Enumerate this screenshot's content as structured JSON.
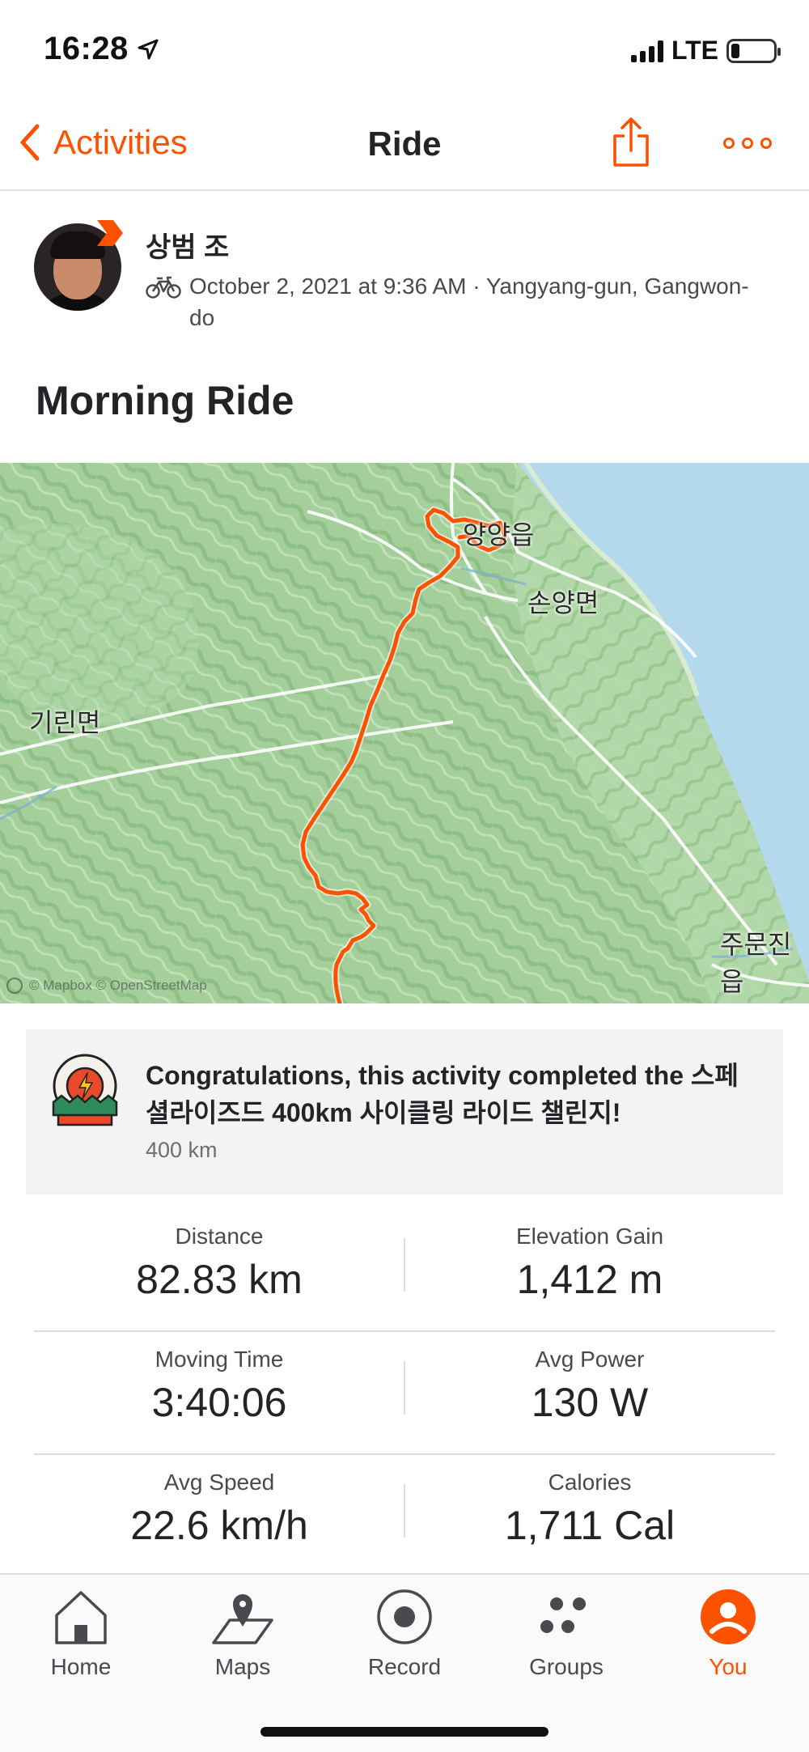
{
  "status_bar": {
    "time": "16:28",
    "network": "LTE",
    "icons": [
      "location-arrow-icon",
      "signal-icon",
      "battery-icon"
    ]
  },
  "nav": {
    "back_label": "Activities",
    "title": "Ride",
    "icons": [
      "chevron-left-icon",
      "share-icon",
      "more-icon"
    ]
  },
  "athlete": {
    "name": "상범 조",
    "meta": "October 2, 2021 at 9:36 AM · Yangyang-gun, Gangwon-do",
    "activity_icon": "bike-icon"
  },
  "activity": {
    "title": "Morning Ride"
  },
  "map": {
    "labels": {
      "town_yangyang": "양양읍",
      "town_sonyang": "손양면",
      "town_girin": "기린면",
      "town_jumunjin": "주문진읍"
    },
    "attribution": "© Mapbox © OpenStreetMap",
    "route_color": "#fc5200",
    "water_color": "#b5d9ec",
    "land_color": "#a9d2a0"
  },
  "achievement": {
    "text": "Congratulations, this activity completed the 스페셜라이즈드 400km 사이클링 라이드 챌린지!",
    "subtext": "400 km",
    "badge_icon": "challenge-badge-icon"
  },
  "stats": [
    {
      "label": "Distance",
      "value": "82.83 km"
    },
    {
      "label": "Elevation Gain",
      "value": "1,412 m"
    },
    {
      "label": "Moving Time",
      "value": "3:40:06"
    },
    {
      "label": "Avg Power",
      "value": "130 W"
    },
    {
      "label": "Avg Speed",
      "value": "22.6 km/h"
    },
    {
      "label": "Calories",
      "value": "1,711 Cal"
    }
  ],
  "tabs": [
    {
      "label": "Home",
      "icon": "home-icon",
      "active": false
    },
    {
      "label": "Maps",
      "icon": "maps-icon",
      "active": false
    },
    {
      "label": "Record",
      "icon": "record-icon",
      "active": false
    },
    {
      "label": "Groups",
      "icon": "groups-icon",
      "active": false
    },
    {
      "label": "You",
      "icon": "profile-icon",
      "active": true
    }
  ],
  "colors": {
    "accent": "#fc5200",
    "text_primary": "#242428",
    "text_secondary": "#494950"
  }
}
